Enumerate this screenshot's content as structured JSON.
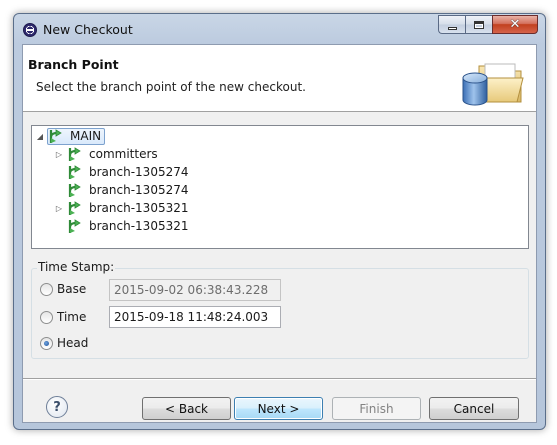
{
  "window": {
    "title": "New Checkout"
  },
  "header": {
    "title": "Branch Point",
    "description": "Select the branch point of the new checkout."
  },
  "tree": {
    "root": {
      "label": "MAIN",
      "expanded": true,
      "selected": true
    },
    "children": [
      {
        "label": "committers",
        "has_children": true
      },
      {
        "label": "branch-1305274",
        "has_children": false
      },
      {
        "label": "branch-1305274",
        "has_children": false
      },
      {
        "label": "branch-1305321",
        "has_children": true
      },
      {
        "label": "branch-1305321",
        "has_children": false
      }
    ]
  },
  "timestamp_group": {
    "label": "Time Stamp:",
    "options": [
      {
        "label": "Base",
        "value": "2015-09-02 06:38:43.228",
        "checked": false,
        "field_enabled": false
      },
      {
        "label": "Time",
        "value": "2015-09-18 11:48:24.003",
        "checked": false,
        "field_enabled": true
      },
      {
        "label": "Head",
        "checked": true
      }
    ]
  },
  "buttons": {
    "help": "?",
    "back": "< Back",
    "next": "Next >",
    "finish": "Finish",
    "cancel": "Cancel"
  },
  "colors": {
    "branch_icon": "#3fa047",
    "selection_border": "#7da2ce",
    "default_button_border": "#3c7fb1"
  },
  "icons": {
    "branch": "branch-icon",
    "help": "help-icon",
    "wizard": "folder-database-icon"
  }
}
